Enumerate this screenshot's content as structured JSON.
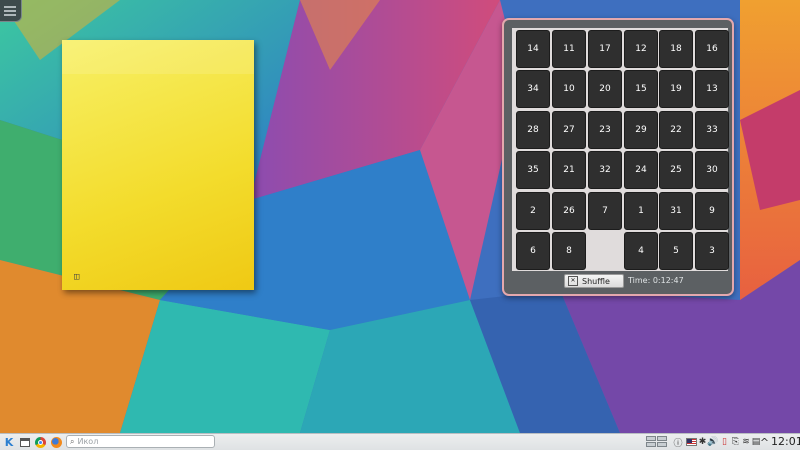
{
  "sticky_note": {
    "text": "",
    "icon": "◫"
  },
  "puzzle": {
    "rows": [
      [
        "14",
        "11",
        "17",
        "12",
        "18",
        "16"
      ],
      [
        "34",
        "10",
        "20",
        "15",
        "19",
        "13"
      ],
      [
        "28",
        "27",
        "23",
        "29",
        "22",
        "33"
      ],
      [
        "35",
        "21",
        "32",
        "24",
        "25",
        "30"
      ],
      [
        "2",
        "26",
        "7",
        "1",
        "31",
        "9"
      ],
      [
        "6",
        "8",
        "",
        "4",
        "5",
        "3"
      ]
    ],
    "shuffle_label": "Shuffle",
    "time_text": "Time: 0:12:47"
  },
  "taskbar": {
    "search_placeholder": "Икол",
    "clock": "12:01",
    "icons": [
      "kde-launcher-icon",
      "file-manager-icon",
      "chrome-icon",
      "firefox-icon"
    ]
  },
  "colors": {
    "tile": "#2f2f2f",
    "widget_border": "#e4a8ad",
    "sticky": "#f3dc2c"
  }
}
